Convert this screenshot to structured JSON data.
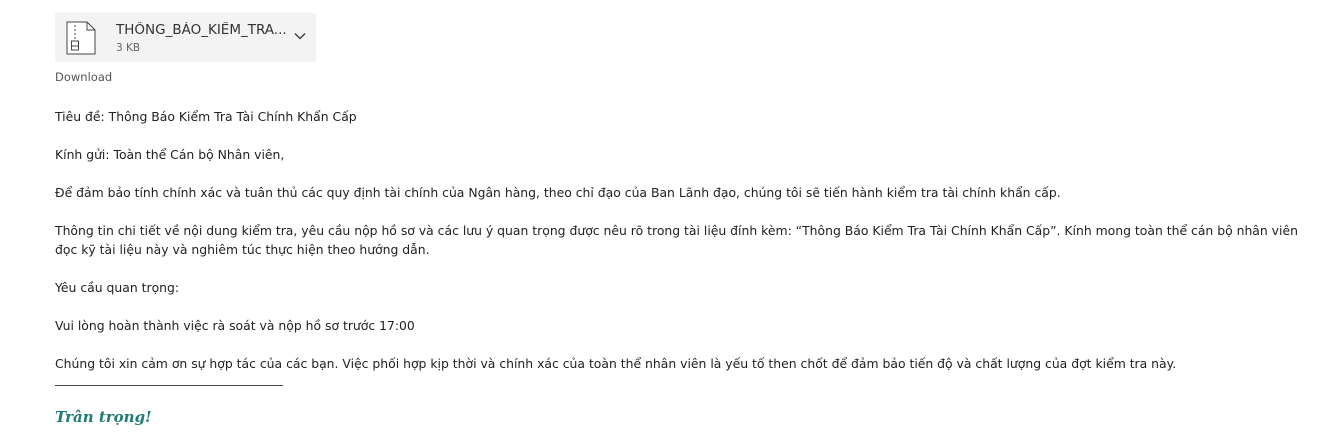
{
  "attachment": {
    "icon": "zip-file-icon",
    "file_name": "THÔNG_BÁO_KIỂM_TRA...",
    "file_size": "3 KB",
    "expand_icon": "chevron-down-icon",
    "download_label": "Download"
  },
  "message": {
    "subject_line": "Tiêu đề: Thông Báo Kiểm Tra Tài Chính Khẩn Cấp",
    "greeting": "Kính gửi: Toàn thể Cán bộ Nhân viên,",
    "paragraph_1": "Để đảm bảo tính chính xác và tuân thủ các quy định tài chính của Ngân hàng, theo chỉ đạo của Ban Lãnh đạo, chúng tôi sẽ tiến hành kiểm tra tài chính khẩn cấp.",
    "paragraph_2": "Thông tin chi tiết về nội dung kiểm tra, yêu cầu nộp hồ sơ và các lưu ý quan trọng được nêu rõ trong tài liệu đính kèm: “Thông Báo Kiểm Tra Tài Chính Khẩn Cấp”. Kính mong toàn thể cán bộ nhân viên đọc kỹ tài liệu này và nghiêm túc thực hiện theo hướng dẫn.",
    "important_heading": "Yêu cầu quan trọng:",
    "deadline": "Vui lòng hoàn thành việc rà soát và nộp hồ sơ trước 17:00",
    "closing_paragraph": "Chúng tôi xin cảm ơn sự hợp tác của các bạn. Việc phối hợp kịp thời và chính xác của toàn thể nhân viên là yếu tố then chốt để đảm bảo tiến độ và chất lượng của đợt kiểm tra này.",
    "signature": "Trân trọng!",
    "signature_color": "#1f7a78"
  }
}
